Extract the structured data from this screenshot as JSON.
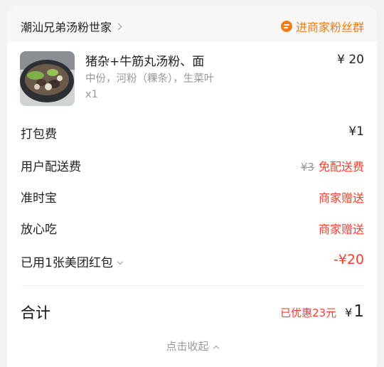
{
  "shop": {
    "name": "潮汕兄弟汤粉世家",
    "fan_group_label": "进商家粉丝群"
  },
  "item": {
    "title": "猪杂+牛筋丸汤粉、面",
    "spec": "中份，河粉（粿条），生菜叶",
    "qty": "x1",
    "price": "¥ 20"
  },
  "fees": {
    "packing_label": "打包费",
    "packing_value": "¥1",
    "delivery_label": "用户配送费",
    "delivery_original": "¥3",
    "delivery_value": "免配送费",
    "ontime_label": "准时宝",
    "ontime_value": "商家赠送",
    "safe_label": "放心吃",
    "safe_value": "商家赠送",
    "coupon_label": "已用1张美团红包",
    "coupon_value": "-¥20"
  },
  "total": {
    "label": "合计",
    "discount": "已优惠23元",
    "yen": "¥",
    "amount": "1"
  },
  "collapse_label": "点击收起",
  "colors": {
    "accent_orange": "#f07d1a",
    "accent_red": "#ff3d2e"
  }
}
